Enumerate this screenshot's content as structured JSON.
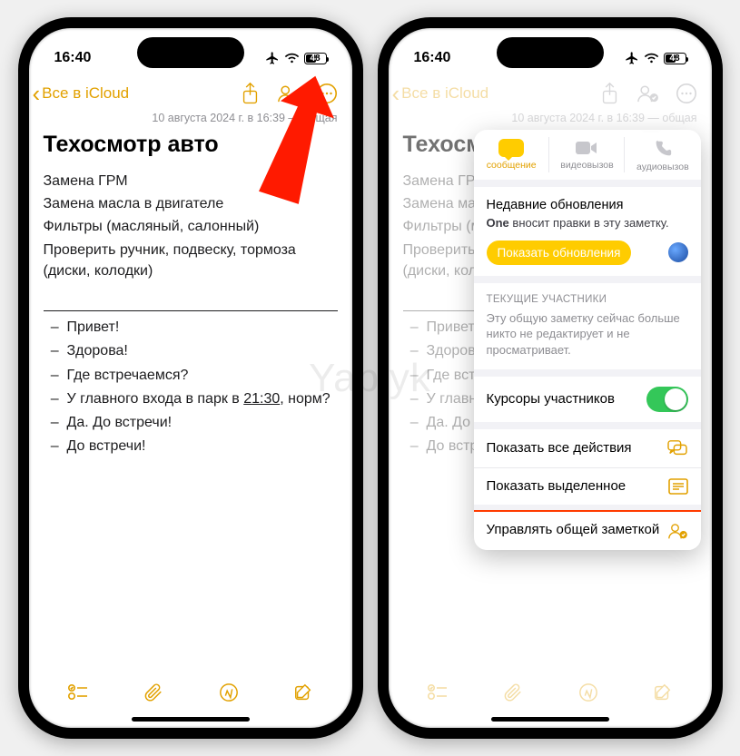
{
  "watermark": "Yablyk",
  "status": {
    "time": "16:40",
    "battery_pct": 48
  },
  "note": {
    "back_label": "Все в iCloud",
    "meta": "10 августа 2024 г. в 16:39 — общая",
    "title": "Техосмотр авто",
    "lines": [
      "Замена ГРМ",
      "Замена масла в двигателе",
      "Фильтры (масляный, салонный)",
      "Проверить ручник, подвеску, тормоза (диски, колодки)"
    ],
    "chat": {
      "l1": "Привет!",
      "l2": "Здорова!",
      "l3": "Где встречаемся?",
      "l4_pre": "У главного входа в парк в ",
      "l4_time": "21:30",
      "l4_post": ", норм?",
      "l5": "Да. До встречи!",
      "l6": "До встречи!"
    }
  },
  "popover": {
    "act_message": "сообщение",
    "act_video": "видеовызов",
    "act_audio": "аудиовызов",
    "updates_header": "Недавние обновления",
    "updates_text_bold": "One",
    "updates_text_rest": " вносит правки в эту заметку.",
    "show_updates_btn": "Показать обновления",
    "participants_header": "ТЕКУЩИЕ УЧАСТНИКИ",
    "participants_text": "Эту общую заметку сейчас больше никто не редактирует и не просматривает.",
    "cursors": "Курсоры участников",
    "show_all_actions": "Показать все действия",
    "show_highlighted": "Показать выделенное",
    "manage_shared": "Управлять общей заметкой"
  }
}
